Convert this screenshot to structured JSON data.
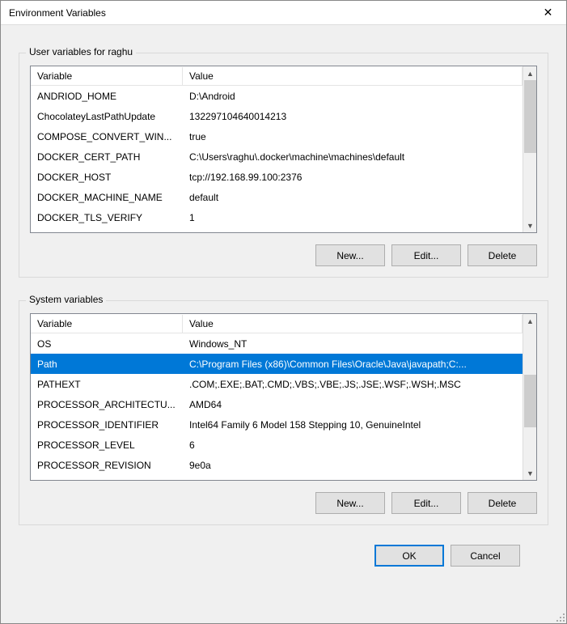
{
  "titlebar": {
    "title": "Environment Variables",
    "close": "✕"
  },
  "user_section": {
    "label": "User variables for raghu",
    "columns": {
      "variable": "Variable",
      "value": "Value"
    },
    "rows": [
      {
        "variable": "ANDRIOD_HOME",
        "value": "D:\\Android"
      },
      {
        "variable": "ChocolateyLastPathUpdate",
        "value": "132297104640014213"
      },
      {
        "variable": "COMPOSE_CONVERT_WIN...",
        "value": "true"
      },
      {
        "variable": "DOCKER_CERT_PATH",
        "value": "C:\\Users\\raghu\\.docker\\machine\\machines\\default"
      },
      {
        "variable": "DOCKER_HOST",
        "value": "tcp://192.168.99.100:2376"
      },
      {
        "variable": "DOCKER_MACHINE_NAME",
        "value": "default"
      },
      {
        "variable": "DOCKER_TLS_VERIFY",
        "value": "1"
      }
    ],
    "buttons": {
      "new": "New...",
      "edit": "Edit...",
      "delete": "Delete"
    }
  },
  "system_section": {
    "label": "System variables",
    "columns": {
      "variable": "Variable",
      "value": "Value"
    },
    "rows": [
      {
        "variable": "OS",
        "value": "Windows_NT"
      },
      {
        "variable": "Path",
        "value": "C:\\Program Files (x86)\\Common Files\\Oracle\\Java\\javapath;C:...",
        "selected": true
      },
      {
        "variable": "PATHEXT",
        "value": ".COM;.EXE;.BAT;.CMD;.VBS;.VBE;.JS;.JSE;.WSF;.WSH;.MSC"
      },
      {
        "variable": "PROCESSOR_ARCHITECTU...",
        "value": "AMD64"
      },
      {
        "variable": "PROCESSOR_IDENTIFIER",
        "value": "Intel64 Family 6 Model 158 Stepping 10, GenuineIntel"
      },
      {
        "variable": "PROCESSOR_LEVEL",
        "value": "6"
      },
      {
        "variable": "PROCESSOR_REVISION",
        "value": "9e0a"
      }
    ],
    "buttons": {
      "new": "New...",
      "edit": "Edit...",
      "delete": "Delete"
    }
  },
  "footer": {
    "ok": "OK",
    "cancel": "Cancel"
  },
  "glyphs": {
    "up": "▲",
    "down": "▼"
  }
}
